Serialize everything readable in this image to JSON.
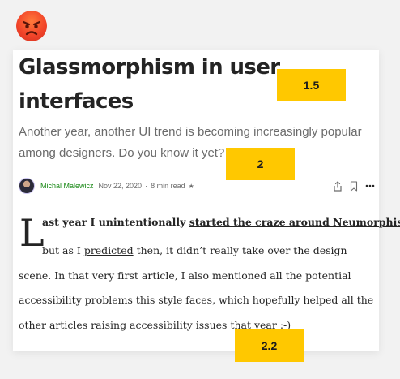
{
  "article": {
    "title": "Glassmorphism in user interfaces",
    "subtitle": "Another year, another UI trend is becoming increasingly popular among designers. Do you know it yet?",
    "author": "Michal Malewicz",
    "date": "Nov 22, 2020",
    "read_time": "8 min read",
    "star": "★",
    "dropcap": "L",
    "first_line_pre": "ast year I unintentionally ",
    "first_line_link": "started the craze around Neumorphism",
    "first_line_post": ",",
    "para_pre": "but as I ",
    "para_link": "predicted",
    "para_post": " then, it didn’t really take over the design scene. In that very first article, I also mentioned all the potential accessibility problems this style faces, which hopefully helped all the other articles raising accessibility issues that year :-)"
  },
  "icons": {
    "emoji": "angry-face-icon",
    "share": "share-icon",
    "bookmark": "bookmark-icon",
    "more": "more-icon"
  },
  "badges": {
    "badge_1": "1.5",
    "badge_2": "2",
    "badge_3": "2.2"
  },
  "colors": {
    "badge": "#ffc800",
    "author_link": "#1a8917",
    "background": "#f2f2f2"
  }
}
